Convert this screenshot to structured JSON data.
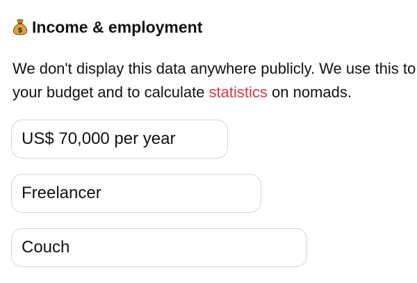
{
  "section": {
    "title": "Income & employment",
    "icon": "money-bag-icon"
  },
  "description": {
    "line1": "We don't display this data anywhere publicly. We use this to calculate",
    "line2_before": "your budget and to calculate ",
    "line2_link": "statistics",
    "line2_after": " on nomads."
  },
  "fields": {
    "income": "US$ 70,000 per year",
    "employment": "Freelancer",
    "housing": "Couch"
  },
  "colors": {
    "link": "#d9363e",
    "border": "#d6d6d6"
  }
}
